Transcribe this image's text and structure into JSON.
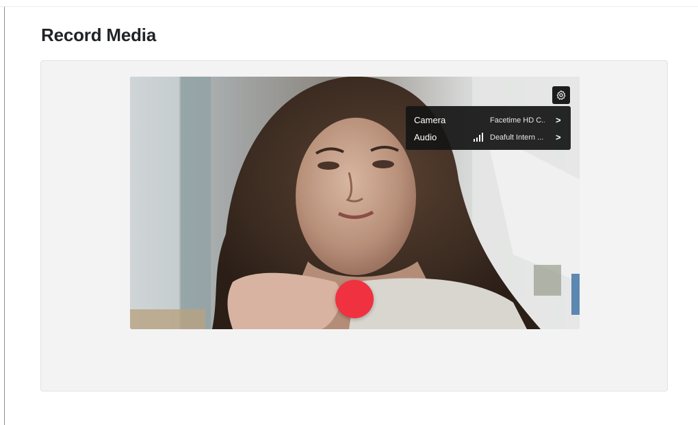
{
  "page": {
    "title": "Record Media"
  },
  "recorder": {
    "settings_icon": "gear-icon",
    "settings_menu": {
      "items": [
        {
          "label": "Camera",
          "value": "Facetime HD C...",
          "icon": "chevron-right-icon"
        },
        {
          "label": "Audio",
          "value": "Deafult Intern ...",
          "level_icon": "audio-level-icon",
          "icon": "chevron-right-icon"
        }
      ]
    },
    "record_button_icon": "record-icon",
    "record_color": "#f03140"
  },
  "colors": {
    "panel_bg": "#f3f3f3",
    "menu_bg": "#161616",
    "title": "#202327"
  }
}
